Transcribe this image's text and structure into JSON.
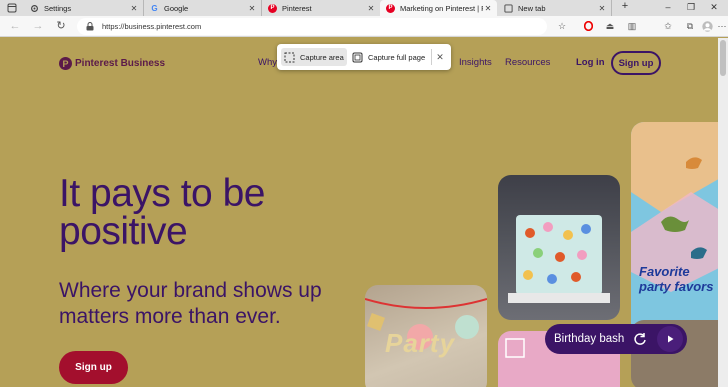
{
  "browser": {
    "tabs": [
      {
        "label": "Settings",
        "icon": "settings-icon"
      },
      {
        "label": "Google",
        "icon": "google-icon"
      },
      {
        "label": "Pinterest",
        "icon": "pinterest-icon"
      },
      {
        "label": "Marketing on Pinterest | Pinte",
        "icon": "pinterest-icon",
        "active": true
      },
      {
        "label": "New tab",
        "icon": "new-tab-icon"
      }
    ],
    "new_tab_label": "+",
    "url": "https://business.pinterest.com"
  },
  "capture": {
    "area_label": "Capture area",
    "full_label": "Capture full page"
  },
  "header": {
    "brand": "Pinterest Business",
    "nav": [
      "Why",
      "Insights",
      "Resources"
    ],
    "login": "Log in",
    "signup": "Sign up"
  },
  "hero": {
    "title": "It pays to be positive",
    "subtitle": "Where your brand shows up matters more than ever.",
    "cta": "Sign up"
  },
  "collage": {
    "favor_text": "Favorite party favors",
    "party_text": "Party",
    "board_label": "Birthday bash"
  },
  "colors": {
    "page_bg": "#b5a057",
    "brand_purple": "#3b1466",
    "cta_red": "#a30f2d"
  }
}
